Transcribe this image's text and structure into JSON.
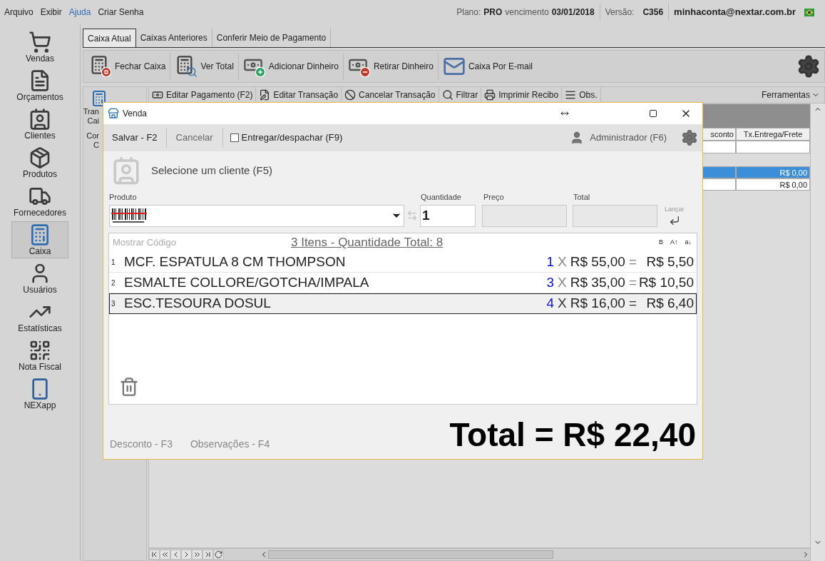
{
  "menu": [
    {
      "label": "Arquivo",
      "highlighted": false
    },
    {
      "label": "Exibir",
      "highlighted": false
    },
    {
      "label": "Ajuda",
      "highlighted": true
    },
    {
      "label": "Criar Senha",
      "highlighted": false
    }
  ],
  "account": {
    "plan_label": "Plano:",
    "plan": "PRO",
    "due_label": "vencimento",
    "due": "03/01/2018",
    "version_label": "Versão:",
    "version": "C356",
    "email": "minhaconta@nextar.com.br"
  },
  "sidebar": {
    "items": [
      {
        "label": "Vendas",
        "selected": false
      },
      {
        "label": "Orçamentos",
        "selected": false
      },
      {
        "label": "Clientes",
        "selected": false
      },
      {
        "label": "Produtos",
        "selected": false
      },
      {
        "label": "Fornecedores",
        "selected": false
      },
      {
        "label": "Caixa",
        "selected": true
      },
      {
        "label": "Usuários",
        "selected": false
      },
      {
        "label": "Estatísticas",
        "selected": false
      },
      {
        "label": "Nota Fiscal",
        "selected": false
      },
      {
        "label": "NEXapp",
        "selected": false
      }
    ]
  },
  "tabs": [
    {
      "label": "Caixa Atual",
      "selected": true
    },
    {
      "label": "Caixas Anteriores",
      "selected": false
    },
    {
      "label": "Conferir Meio de Pagamento",
      "selected": false
    }
  ],
  "toolbar": {
    "buttons": [
      "Fechar Caixa",
      "Ver Total",
      "Adicionar Dinheiro",
      "Retirar Dinheiro",
      "Caixa Por E-mail"
    ]
  },
  "side_panel": {
    "items": [
      {
        "lines": [
          "Tran",
          "Cai"
        ]
      },
      {
        "lines": [
          "Cor",
          "C"
        ]
      }
    ]
  },
  "actions": {
    "buttons": [
      "Editar Pagamento (F2)",
      "Editar Transação",
      "Cancelar Transação",
      "Filtrar",
      "Imprimir Recibo",
      "Obs."
    ],
    "menu": "Ferramentas"
  },
  "grid": {
    "columns": [
      "sconto",
      "Tx.Entrega/Frete"
    ],
    "rows": [
      {
        "value": "R$ 0,00",
        "selected": true
      },
      {
        "value": "R$ 0,00",
        "selected": false
      }
    ]
  },
  "dialog": {
    "title": "Venda",
    "save": "Salvar - F2",
    "cancel": "Cancelar",
    "deliver": {
      "label": "Entregar/despachar (F9)",
      "checked": false
    },
    "user": "Administrador (F6)",
    "client": "Selecione um cliente (F5)",
    "fields": {
      "product_label": "Produto",
      "quantity_label": "Quantidade",
      "quantity": "1",
      "price_label": "Preço",
      "total_label": "Total",
      "launch": "Lançar"
    },
    "list": {
      "show_code": "Mostrar Código",
      "summary": "3 Itens - Quantidade Total: 8",
      "sort_buttons": [
        "B",
        "A↑",
        "a↓"
      ],
      "items": [
        {
          "index": "1",
          "name": "MCF. ESPATULA 8 CM THOMPSON",
          "qty": "1",
          "times": "X",
          "price": "R$ 55,00",
          "equals": "=",
          "total": "R$ 5,50",
          "selected": false
        },
        {
          "index": "2",
          "name": "ESMALTE COLLORE/GOTCHA/IMPALA",
          "qty": "3",
          "times": "X",
          "price": "R$ 35,00",
          "equals": "=",
          "total": "R$ 10,50",
          "selected": false
        },
        {
          "index": "3",
          "name": "ESC.TESOURA DOSUL",
          "qty": "4",
          "times": "X",
          "price": "R$ 16,00",
          "equals": "=",
          "total": "R$ 6,40",
          "selected": true
        }
      ]
    },
    "discount": "Desconto - F3",
    "notes": "Observações - F4",
    "total": "Total = R$ 22,40"
  }
}
